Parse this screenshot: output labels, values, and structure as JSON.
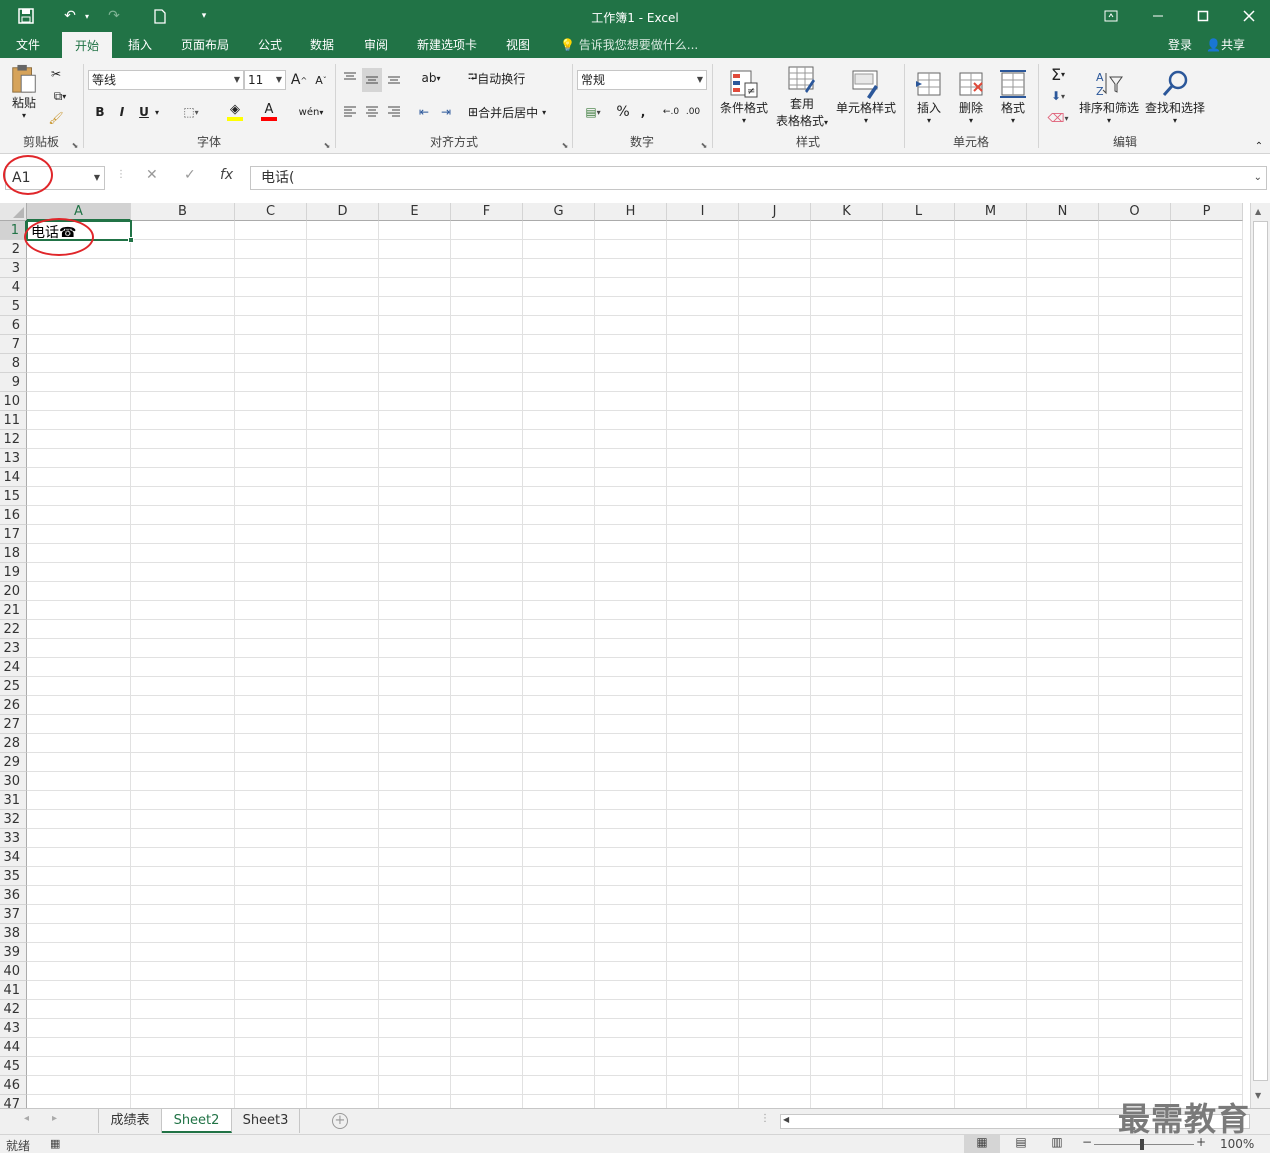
{
  "titlebar": {
    "title": "工作簿1 - Excel",
    "save_icon": "save-icon",
    "undo_icon": "undo-icon",
    "redo_icon": "redo-icon",
    "new_icon": "new-document-icon",
    "customize_icon": "customize-quick-access-icon"
  },
  "tabs": [
    "文件",
    "开始",
    "插入",
    "页面布局",
    "公式",
    "数据",
    "审阅",
    "新建选项卡",
    "视图"
  ],
  "active_tab": "开始",
  "tell_me": "告诉我您想要做什么...",
  "login": "登录",
  "share": "共享",
  "ribbon": {
    "clipboard": {
      "paste": "粘贴",
      "label": "剪贴板"
    },
    "font": {
      "font_name": "等线",
      "font_size": "11",
      "bold": "B",
      "italic": "I",
      "underline": "U",
      "label": "字体"
    },
    "alignment": {
      "wrap": "自动换行",
      "merge": "合并后居中",
      "label": "对齐方式"
    },
    "number": {
      "format": "常规",
      "percent": "%",
      "comma": ",",
      "label": "数字"
    },
    "styles": {
      "conditional": "条件格式",
      "table1": "套用",
      "table2": "表格格式",
      "cell_styles": "单元格样式",
      "label": "样式"
    },
    "cells": {
      "insert": "插入",
      "delete": "删除",
      "format": "格式",
      "label": "单元格"
    },
    "editing": {
      "sort": "排序和筛选",
      "find": "查找和选择",
      "label": "编辑"
    }
  },
  "formula_bar": {
    "name_box": "A1",
    "cancel": "✕",
    "enter": "✓",
    "fx": "fx",
    "content": "电话("
  },
  "grid": {
    "columns": [
      "A",
      "B",
      "C",
      "D",
      "E",
      "F",
      "G",
      "H",
      "I",
      "J",
      "K",
      "L",
      "M",
      "N",
      "O",
      "P"
    ],
    "rows": [
      "1",
      "2",
      "3",
      "4",
      "5",
      "6",
      "7",
      "8",
      "9",
      "10",
      "11",
      "12",
      "13",
      "14",
      "15",
      "16",
      "17",
      "18",
      "19",
      "20",
      "21",
      "22",
      "23",
      "24",
      "25",
      "26",
      "27",
      "28",
      "29",
      "30",
      "31",
      "32",
      "33",
      "34",
      "35",
      "36",
      "37",
      "38",
      "39",
      "40",
      "41",
      "42",
      "43",
      "44",
      "45",
      "46",
      "47"
    ],
    "selected_cell": "A1",
    "a1_text": "电话",
    "a1_symbol": "☎"
  },
  "sheets": [
    "成绩表",
    "Sheet2",
    "Sheet3"
  ],
  "active_sheet": "Sheet2",
  "status": {
    "ready": "就绪",
    "zoom": "100%"
  },
  "watermark": "最需教育",
  "colors": {
    "accent": "#217346",
    "annotation": "#e0262a"
  }
}
